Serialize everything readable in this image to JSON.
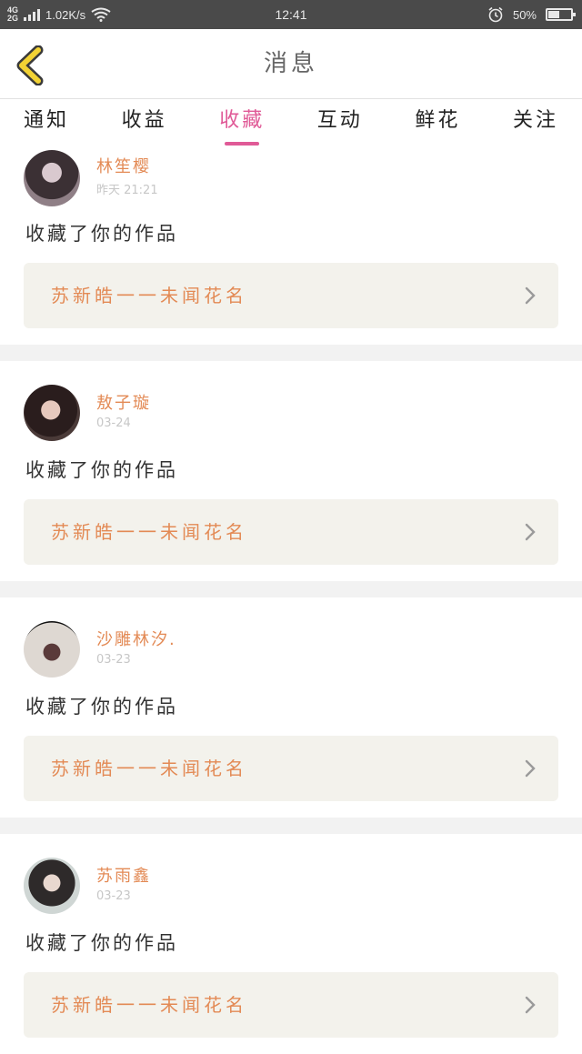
{
  "status_bar": {
    "network_top": "4G",
    "network_bottom": "2G",
    "speed": "1.02K/s",
    "time": "12:41",
    "battery_percent": "50%",
    "battery_level": 0.5
  },
  "header": {
    "title": "消息",
    "back_icon": "chevron-left-icon",
    "accent_color": "#f2d234"
  },
  "tabs": [
    {
      "label": "通知",
      "active": false
    },
    {
      "label": "收益",
      "active": false
    },
    {
      "label": "收藏",
      "active": true
    },
    {
      "label": "互动",
      "active": false
    },
    {
      "label": "鲜花",
      "active": false
    },
    {
      "label": "关注",
      "active": false
    }
  ],
  "colors": {
    "active_tab": "#e05a97",
    "username": "#e38a55",
    "work_card_bg": "#f3f2ec"
  },
  "messages": [
    {
      "user": "林笙樱",
      "time": "昨天 21:21",
      "action": "收藏了你的作品",
      "work_title": "苏新皓一一未闻花名"
    },
    {
      "user": "敖子璇",
      "time": "03-24",
      "action": "收藏了你的作品",
      "work_title": "苏新皓一一未闻花名"
    },
    {
      "user": "沙雕林汐.",
      "time": "03-23",
      "action": "收藏了你的作品",
      "work_title": "苏新皓一一未闻花名"
    },
    {
      "user": "苏雨鑫",
      "time": "03-23",
      "action": "收藏了你的作品",
      "work_title": "苏新皓一一未闻花名"
    }
  ]
}
